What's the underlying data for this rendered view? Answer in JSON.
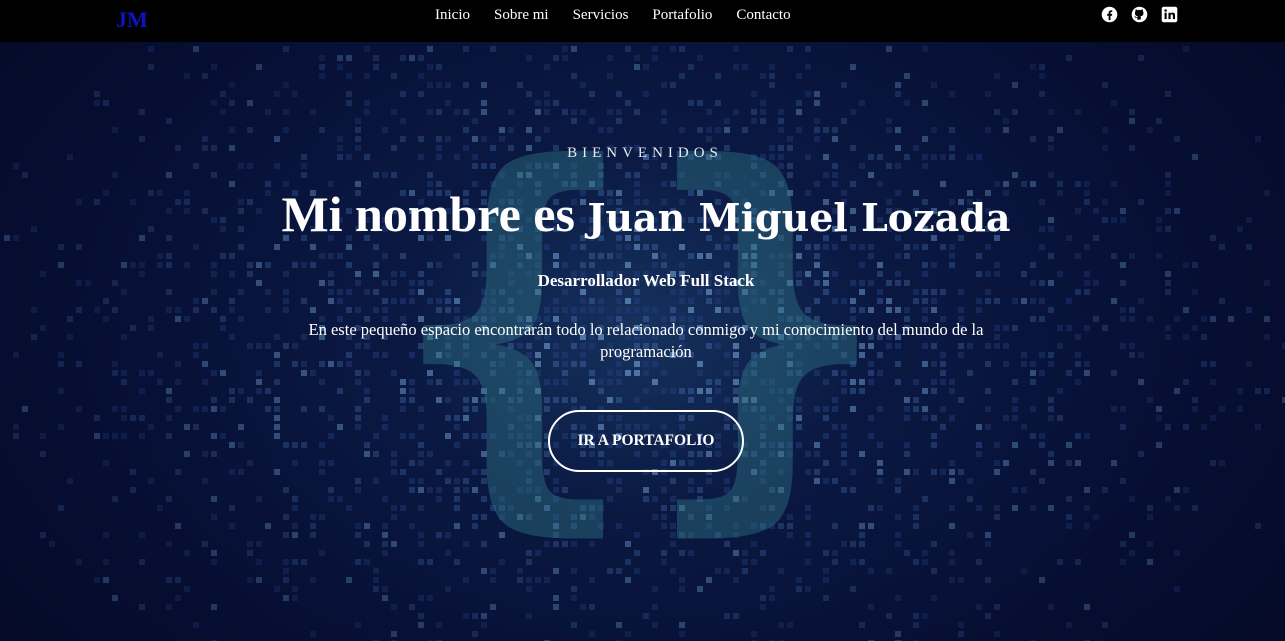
{
  "navbar": {
    "logo": "JM",
    "links": [
      {
        "label": "Inicio"
      },
      {
        "label": "Sobre mi"
      },
      {
        "label": "Servicios"
      },
      {
        "label": "Portafolio"
      },
      {
        "label": "Contacto"
      }
    ],
    "socials": [
      {
        "icon": "facebook-icon"
      },
      {
        "icon": "github-icon"
      },
      {
        "icon": "linkedin-icon"
      }
    ]
  },
  "hero": {
    "welcome": "BIENVENIDOS",
    "title_part1": "Mi nombre es ",
    "title_part2": "Juan Miguel Lozada",
    "subtitle": "Desarrollador Web Full Stack",
    "description": "En este pequeño espacio encontrarán todo lo relacionado conmigo y mi conocimiento del mundo de la programación",
    "cta_label": "IR A PORTAFOLIO",
    "background_glyph": "{}"
  },
  "colors": {
    "navbar_bg": "#000000",
    "logo": "#0d14c8",
    "hero_bg": "#071036",
    "text": "#ffffff",
    "glyph": "#2f6f7a"
  }
}
